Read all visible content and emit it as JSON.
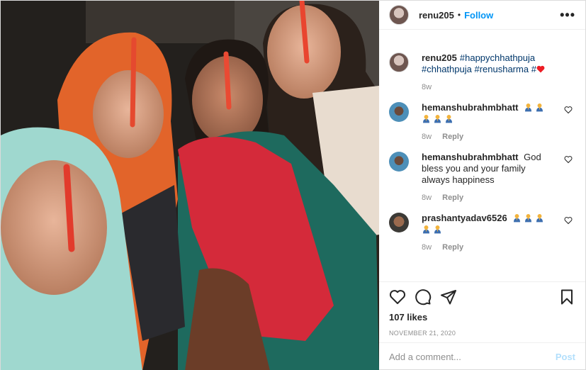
{
  "header": {
    "username": "renu205",
    "separator": "•",
    "follow_label": "Follow",
    "more_icon": "more-options-icon",
    "more_label": "•••"
  },
  "caption": {
    "username": "renu205",
    "hashtags": [
      "#happychhathpuja",
      "#chhathpuja",
      "#renusharma",
      "#"
    ],
    "emoji": "red-heart",
    "age": "8w"
  },
  "comments": [
    {
      "username": "hemanshubrahmbhatt",
      "text": "",
      "emoji_count": 5,
      "emoji": "folded-hands",
      "age": "8w",
      "reply_label": "Reply"
    },
    {
      "username": "hemanshubrahmbhatt",
      "text": "God bless you and your family always happiness",
      "emoji_count": 0,
      "age": "8w",
      "reply_label": "Reply"
    },
    {
      "username": "prashantyadav6526",
      "text": "",
      "emoji_count": 5,
      "emoji": "folded-hands",
      "age": "8w",
      "reply_label": "Reply"
    }
  ],
  "actions": {
    "like_icon": "heart-icon",
    "comment_icon": "comment-bubble-icon",
    "share_icon": "paper-plane-icon",
    "save_icon": "bookmark-icon"
  },
  "likes_label": "107 likes",
  "date_label": "NOVEMBER 21, 2020",
  "add_comment": {
    "placeholder": "Add a comment...",
    "post_label": "Post"
  },
  "colors": {
    "accent": "#0095f6",
    "post_disabled": "#b2dffc",
    "muted": "#8e8e8e",
    "heart_red": "#ed1c24"
  }
}
